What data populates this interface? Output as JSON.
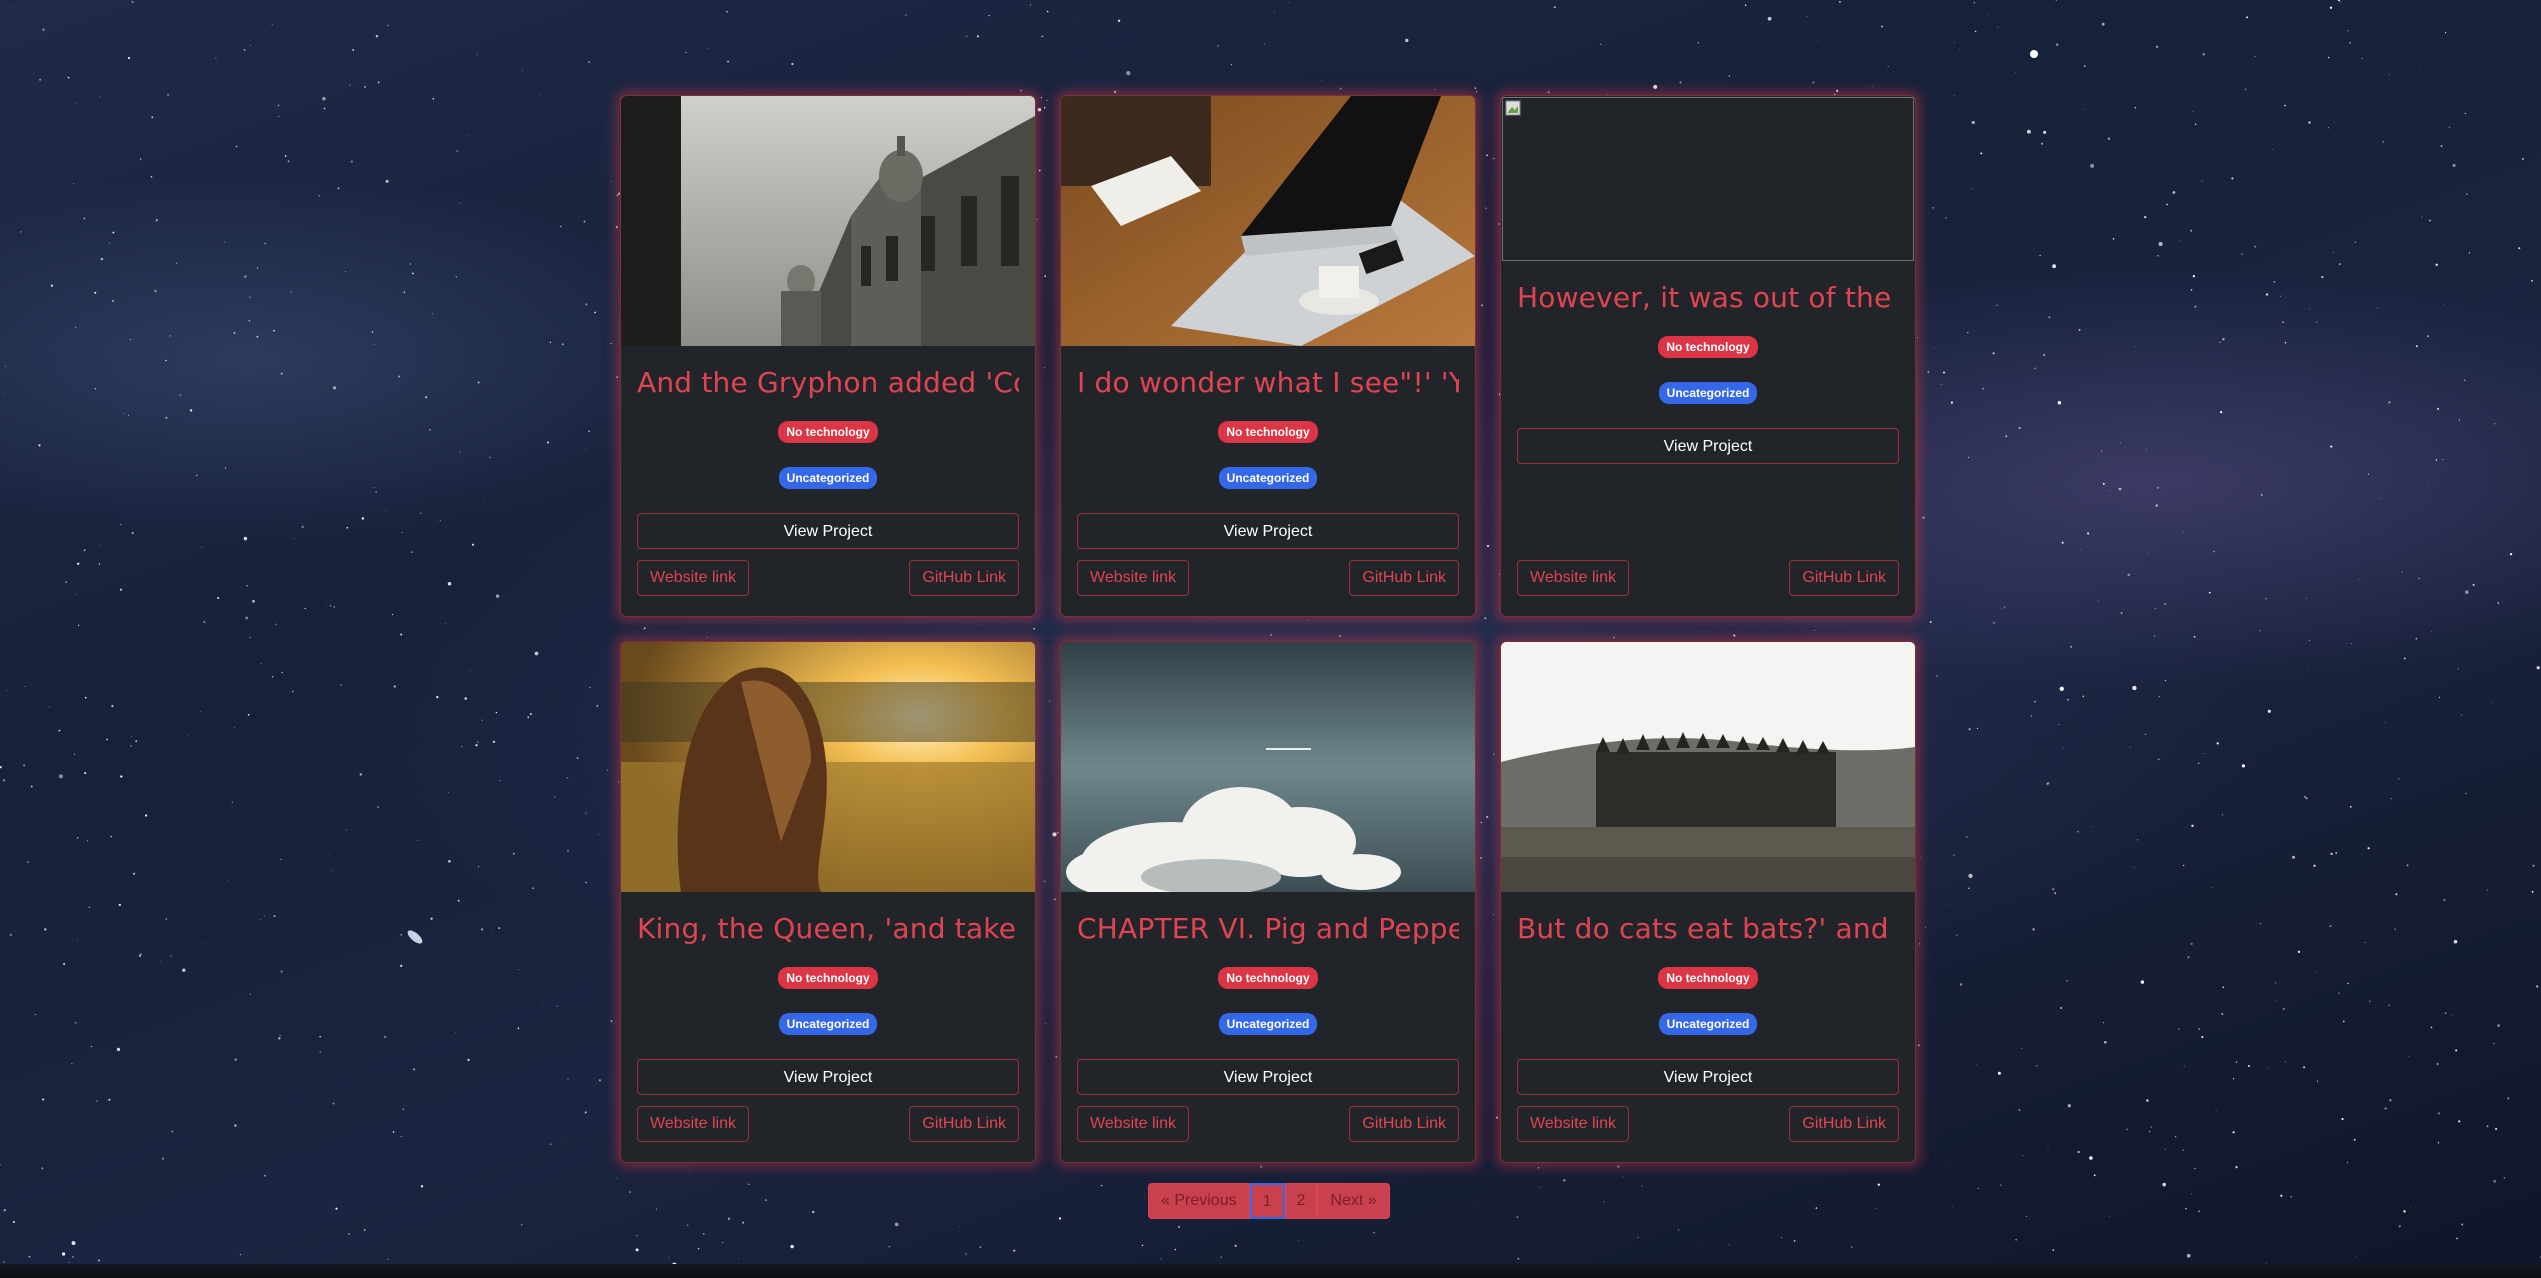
{
  "cards": [
    {
      "title": "And the Gryphon added 'Co...",
      "technology_badge": "No technology",
      "category_badge": "Uncategorized",
      "view_label": "View Project",
      "website_label": "Website link",
      "github_label": "GitHub Link",
      "image": "building-photo"
    },
    {
      "title": "I do wonder what I see\"!' 'Y...",
      "technology_badge": "No technology",
      "category_badge": "Uncategorized",
      "view_label": "View Project",
      "website_label": "Website link",
      "github_label": "GitHub Link",
      "image": "laptop-photo"
    },
    {
      "title": "However, it was out of the j...",
      "technology_badge": "No technology",
      "category_badge": "Uncategorized",
      "view_label": "View Project",
      "website_label": "Website link",
      "github_label": "GitHub Link",
      "image": "broken-image"
    },
    {
      "title": "King, the Queen, 'and take t...",
      "technology_badge": "No technology",
      "category_badge": "Uncategorized",
      "view_label": "View Project",
      "website_label": "Website link",
      "github_label": "GitHub Link",
      "image": "field-woman-photo"
    },
    {
      "title": "CHAPTER VI. Pig and Peppe...",
      "technology_badge": "No technology",
      "category_badge": "Uncategorized",
      "view_label": "View Project",
      "website_label": "Website link",
      "github_label": "GitHub Link",
      "image": "cloud-photo"
    },
    {
      "title": "But do cats eat bats?' and s...",
      "technology_badge": "No technology",
      "category_badge": "Uncategorized",
      "view_label": "View Project",
      "website_label": "Website link",
      "github_label": "GitHub Link",
      "image": "forest-photo"
    }
  ],
  "pagination": {
    "previous": "« Previous",
    "pages": [
      "1",
      "2"
    ],
    "next": "Next »"
  },
  "colors": {
    "accent": "#dc3545",
    "card_bg": "#212529",
    "badge_blue": "#3568e8"
  }
}
